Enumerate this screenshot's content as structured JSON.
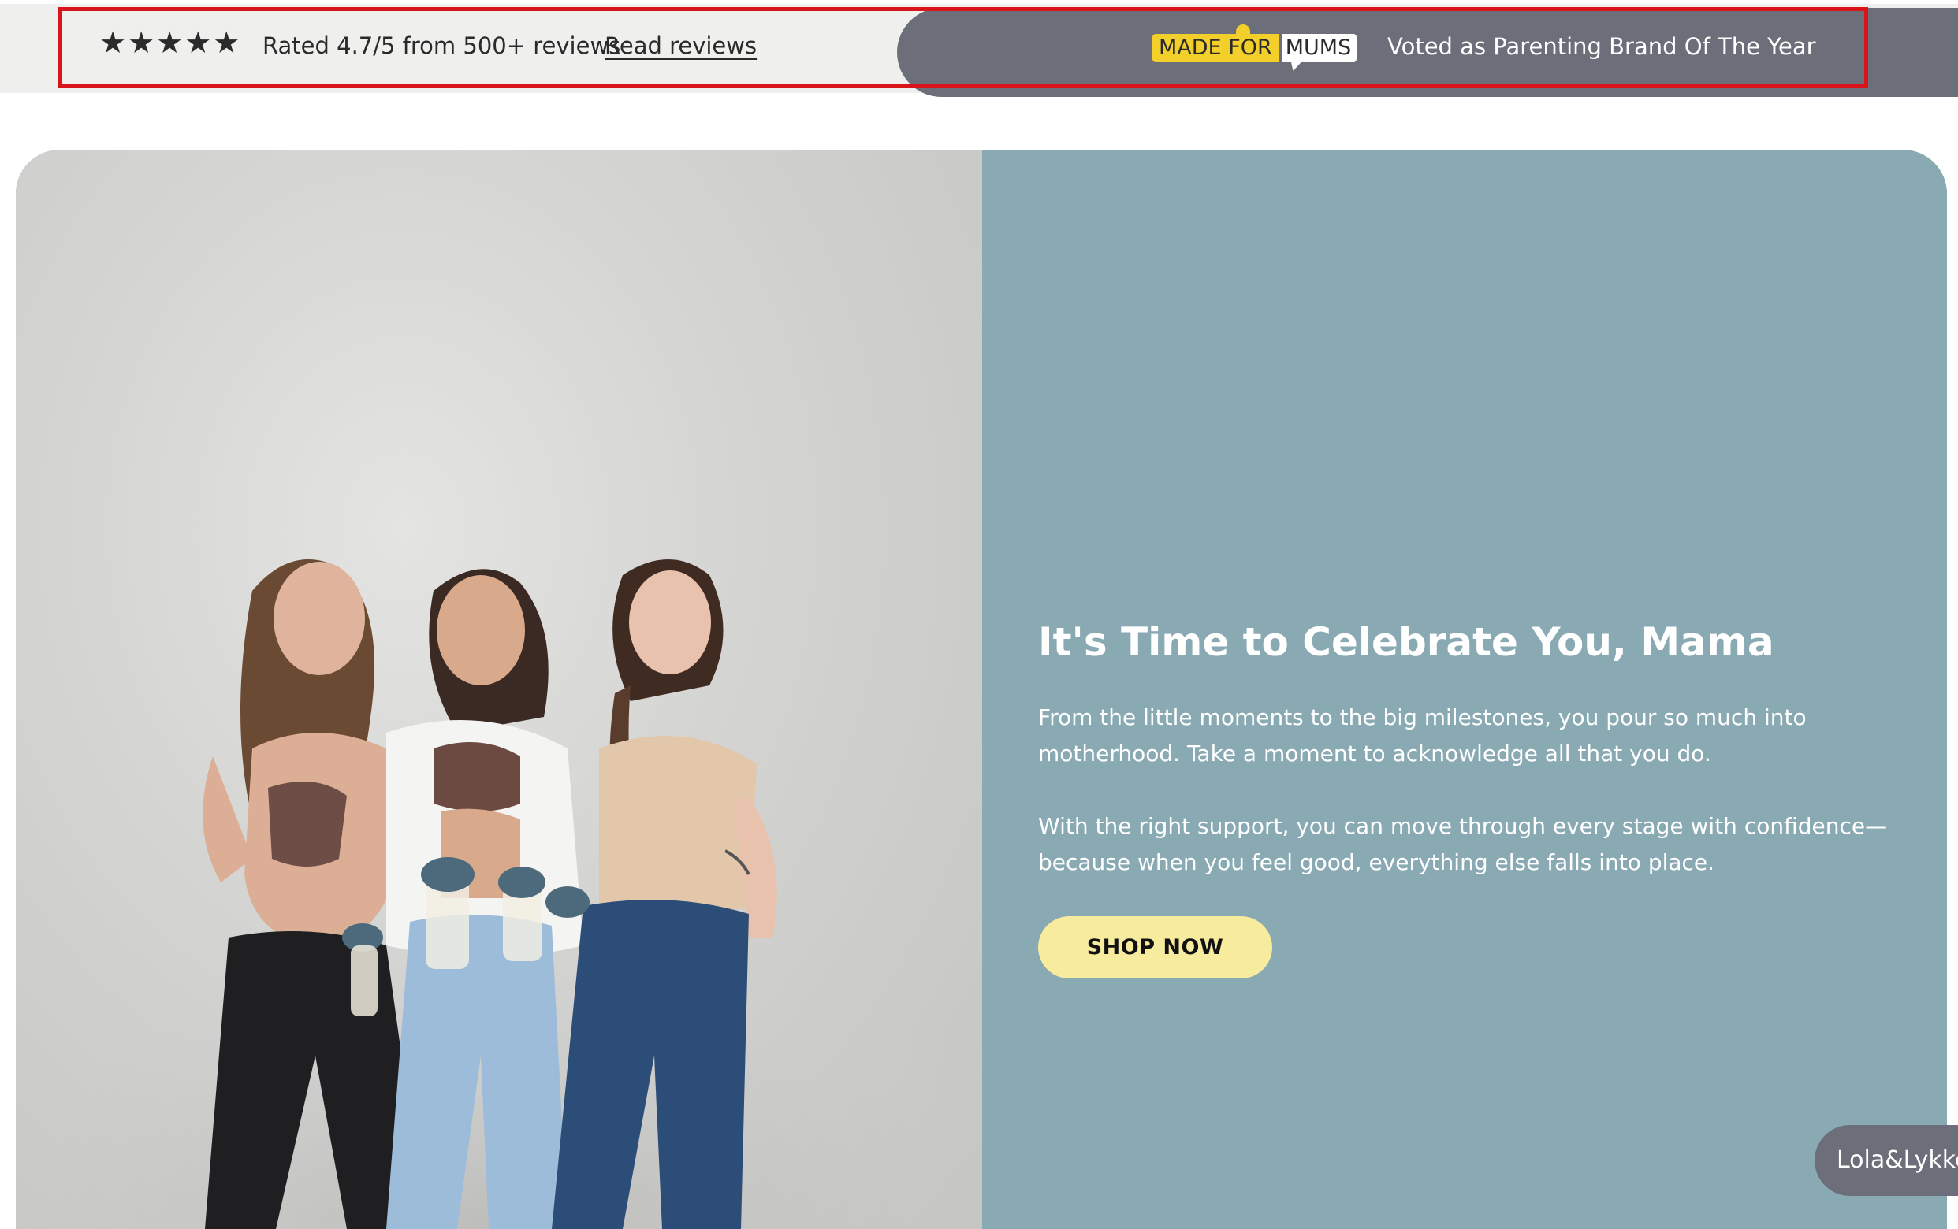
{
  "reviews_bar": {
    "stars": "★★★★★",
    "rating_text": "Rated 4.7/5 from 500+ reviews",
    "read_reviews_label": "Read reviews"
  },
  "award_bar": {
    "badge_made_for": "MADE FOR",
    "badge_mums": "MUMS",
    "award_text": "Voted as Parenting Brand Of The Year"
  },
  "hero": {
    "title": "It's Time to Celebrate You, Mama",
    "paragraph_1": "From the little moments to the big milestones, you pour so much into motherhood. Take a moment to acknowledge all that you do.",
    "paragraph_2": "With the right support, you can move through every stage with confidence—because when you feel good, everything else falls into place.",
    "cta_label": "SHOP NOW"
  },
  "chat_tab": {
    "label": "Lola&Lykke"
  },
  "colors": {
    "topbar_bg": "#efefed",
    "award_bg": "#6c6f7a",
    "badge_yellow": "#f2cf2a",
    "hero_panel_bg": "#8aaab3",
    "cta_bg": "#f7ec9e",
    "highlight_frame": "#d9141b"
  }
}
